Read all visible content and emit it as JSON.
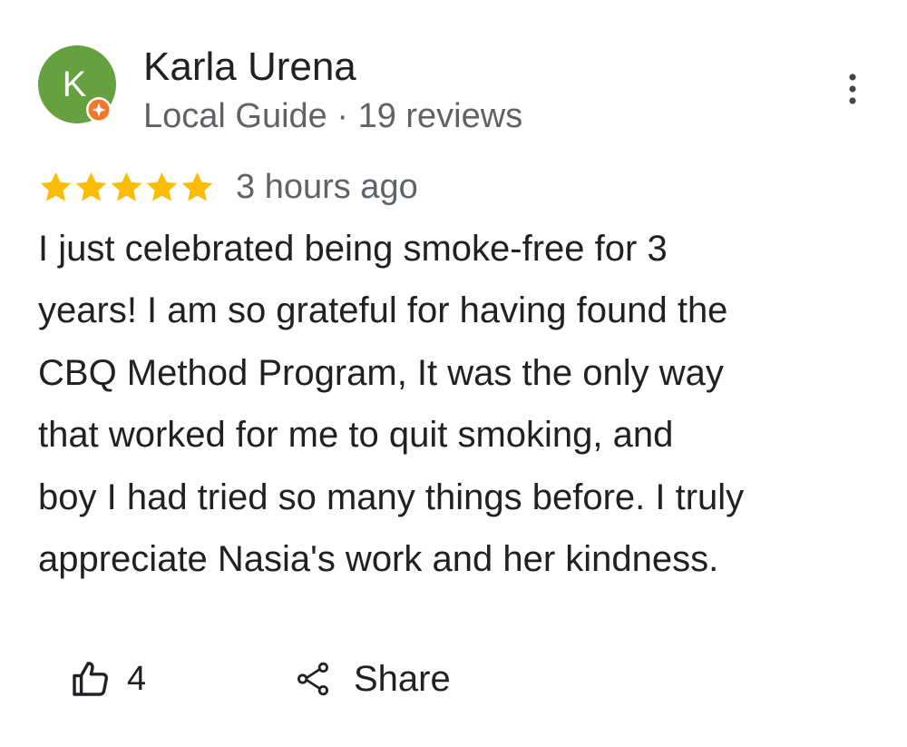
{
  "review": {
    "author": {
      "initial": "K",
      "name": "Karla Urena",
      "meta": "Local Guide · 19 reviews",
      "avatar_color": "#66a140",
      "badge_color": "#f4762a",
      "badge_icon": "local-guide-star-icon"
    },
    "menu_icon": "more-vertical-icon",
    "rating": {
      "stars": 5,
      "max": 5,
      "star_color": "#fbbc04"
    },
    "time": "3 hours ago",
    "text": "I just celebrated being smoke-free for 3\nyears! I am so grateful for  having found the\nCBQ Method Program, It was the only way\nthat worked for me to quit smoking, and\nboy I had tried so many things before. I truly\nappreciate Nasia's work and her kindness.",
    "actions": {
      "like_icon": "thumbs-up-icon",
      "like_count": "4",
      "share_icon": "share-icon",
      "share_label": "Share"
    }
  }
}
